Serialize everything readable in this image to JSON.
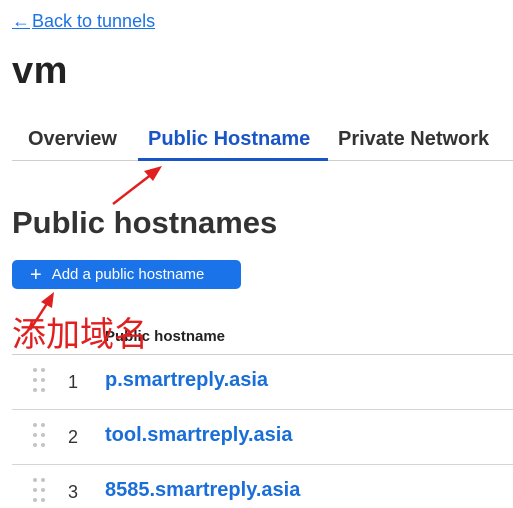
{
  "nav": {
    "back_arrow": "←",
    "back_label": "Back to tunnels"
  },
  "tunnel": {
    "name": "vm"
  },
  "tabs": [
    {
      "label": "Overview",
      "active": false
    },
    {
      "label": "Public Hostname",
      "active": true
    },
    {
      "label": "Private Network",
      "active": false
    }
  ],
  "section": {
    "title": "Public hostnames",
    "add_button_icon": "plus-icon",
    "add_button_label": "Add a public hostname"
  },
  "table": {
    "column_header": "Public hostname",
    "rows": [
      {
        "index": "1",
        "hostname": "p.smartreply.asia"
      },
      {
        "index": "2",
        "hostname": "tool.smartreply.asia"
      },
      {
        "index": "3",
        "hostname": "8585.smartreply.asia"
      }
    ]
  },
  "annotation": {
    "text": "添加域名",
    "color": "#e02020"
  },
  "colors": {
    "link": "#1a73e8",
    "active_tab": "#1a55c8",
    "button_bg": "#1a73e8",
    "hostname": "#1a6ed8"
  }
}
